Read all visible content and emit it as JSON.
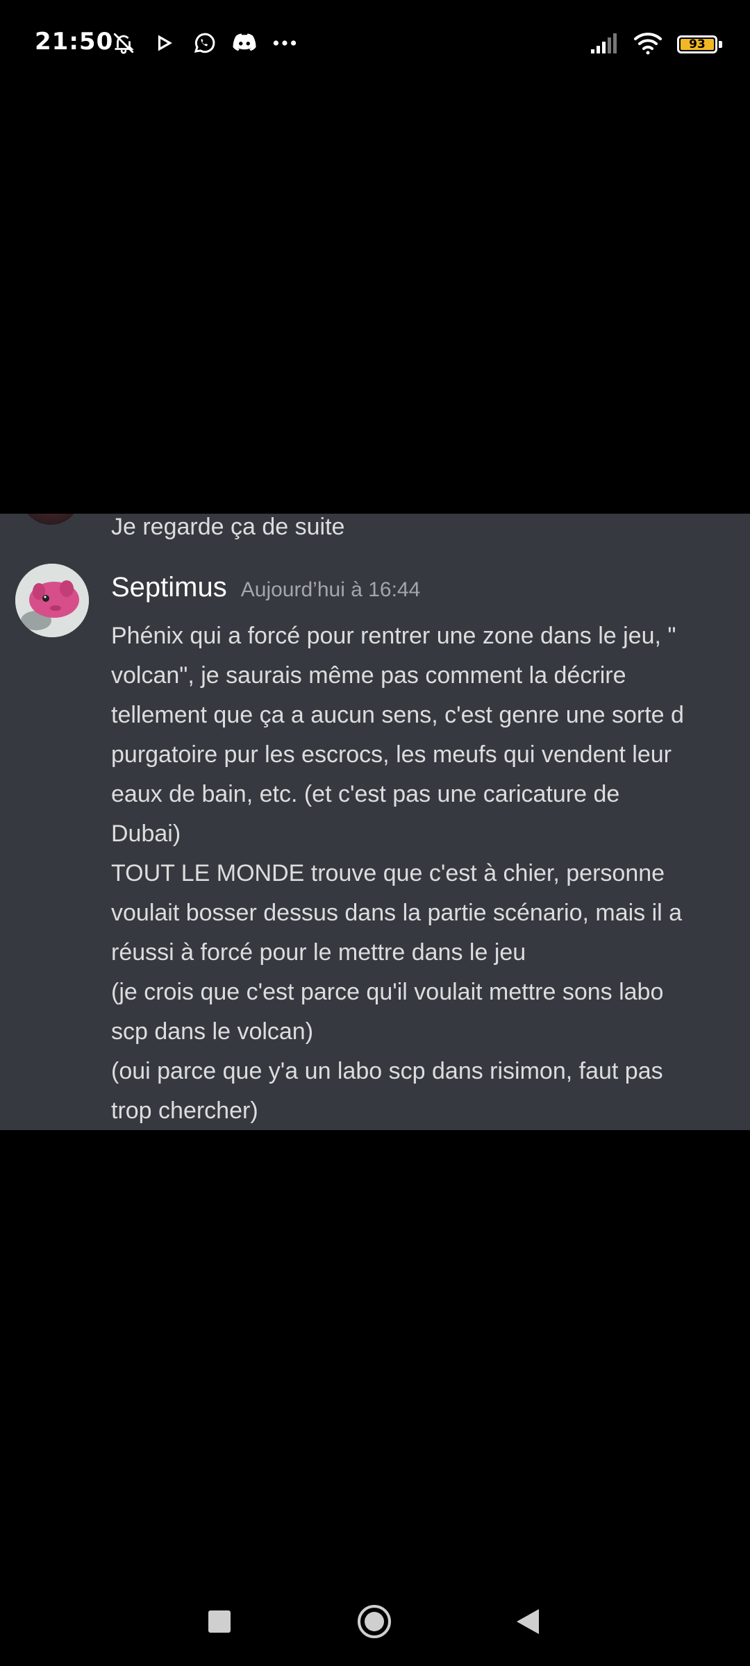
{
  "status_bar": {
    "time": "21:50",
    "battery": "93",
    "left_icons": [
      "bell-off-icon",
      "play-icon",
      "whatsapp-icon",
      "discord-icon",
      "more-dots-icon"
    ],
    "right_icons": [
      "signal-icon",
      "wifi-icon",
      "battery-icon"
    ]
  },
  "chat": {
    "previous_message": "Je regarde ça de suite",
    "message": {
      "username": "Septimus",
      "timestamp": "Aujourd’hui à 16:44",
      "lines": [
        "Phénix qui a forcé pour rentrer une zone dans le jeu, \"",
        "volcan\", je saurais même pas comment la décrire",
        "tellement que ça a aucun sens, c'est genre une sorte d",
        "purgatoire pur les escrocs, les meufs qui vendent leur",
        "eaux de bain, etc. (et c'est pas une caricature de",
        "Dubai)",
        "TOUT LE MONDE trouve que c'est à chier, personne",
        "voulait bosser dessus dans la partie scénario, mais il a",
        "réussi à forcé pour le mettre dans le jeu",
        "(je crois que c'est parce qu'il voulait mettre sons labo",
        "scp dans le volcan)",
        "(oui parce que y'a un labo scp dans risimon, faut pas",
        "trop chercher)"
      ]
    },
    "colors": {
      "background": "#36393f",
      "text": "#dcddde",
      "timestamp": "#a3a6aa"
    }
  },
  "nav_bar": {
    "icons": [
      "recents-square-icon",
      "home-circle-icon",
      "back-triangle-icon"
    ]
  }
}
